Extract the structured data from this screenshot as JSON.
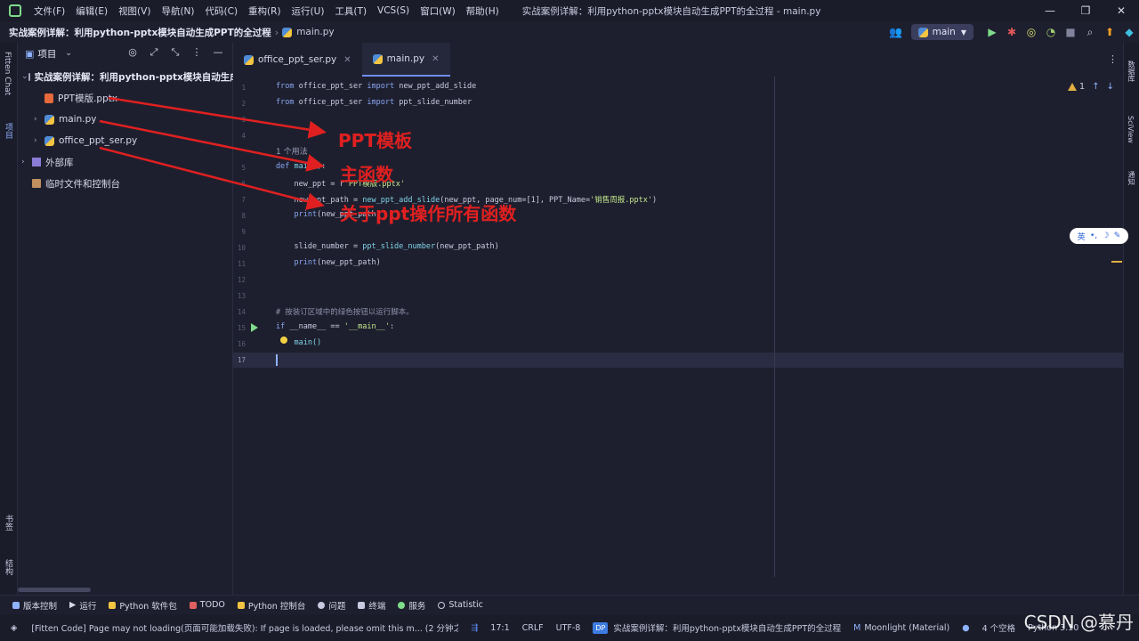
{
  "menu": {
    "items": [
      "文件(F)",
      "编辑(E)",
      "视图(V)",
      "导航(N)",
      "代码(C)",
      "重构(R)",
      "运行(U)",
      "工具(T)",
      "VCS(S)",
      "窗口(W)",
      "帮助(H)"
    ],
    "window_title": "实战案例详解：利用python-pptx模块自动生成PPT的全过程 - main.py"
  },
  "nav": {
    "project": "实战案例详解：利用python-pptx模块自动生成PPT的全过程",
    "file": "main.py",
    "run_config": "main"
  },
  "left_stripe": {
    "fitten": "Fitten Chat",
    "project": "项目",
    "bookmarks": "书签",
    "structure": "结构"
  },
  "project_panel": {
    "title": "项目",
    "tree": [
      {
        "label": "实战案例详解：利用python-pptx模块自动生成PPT的全过程"
      },
      {
        "label": "PPT模版.pptx"
      },
      {
        "label": "main.py"
      },
      {
        "label": "office_ppt_ser.py"
      },
      {
        "label": "外部库"
      },
      {
        "label": "临时文件和控制台"
      }
    ]
  },
  "tabs": [
    {
      "label": "office_ppt_ser.py"
    },
    {
      "label": "main.py"
    }
  ],
  "editor": {
    "line_numbers": [
      "1",
      "2",
      "3",
      "4",
      "5",
      "6",
      "7",
      "8",
      "9",
      "10",
      "11",
      "12",
      "13",
      "14",
      "15",
      "16",
      "17"
    ],
    "usage_hint": "1 个用法",
    "warnings": "1",
    "code": {
      "l1a": "from",
      "l1b": " office_ppt_ser ",
      "l1c": "import",
      "l1d": " new_ppt_add_slide",
      "l2a": "from",
      "l2b": " office_ppt_ser ",
      "l2c": "import",
      "l2d": " ppt_slide_number",
      "l5a": "def",
      "l5b": " main():",
      "l6a": "    new_ppt = r",
      "l6b": "'PPT模版.pptx'",
      "l7a": "    new_ppt_path = ",
      "l7b": "new_ppt_add_slide",
      "l7c": "(new_ppt, page_num=[1], PPT_Name=",
      "l7d": "'销售周报.pptx'",
      "l7e": ")",
      "l8a": "    ",
      "l8b": "print",
      "l8c": "(new_ppt_path)",
      "l10a": "    slide_number = ",
      "l10b": "ppt_slide_number",
      "l10c": "(new_ppt_path)",
      "l11a": "    ",
      "l11b": "print",
      "l11c": "(new_ppt_path)",
      "l14": "# 按装订区域中的绿色按钮以运行脚本。",
      "l15a": "if",
      "l15b": " __name__ == ",
      "l15c": "'__main__'",
      "l15d": ":",
      "l16": "    main()"
    }
  },
  "annotations": {
    "a1": "PPT模板",
    "a2": "主函数",
    "a3": "关于ppt操作所有函数"
  },
  "right_stripe": {
    "db": "数据库",
    "sciview": "SciView",
    "notify": "通知"
  },
  "ime": {
    "a": "英",
    "b": "•,",
    "c": "☽",
    "d": "✎"
  },
  "tool_windows": [
    "版本控制",
    "运行",
    "Python 软件包",
    "TODO",
    "Python 控制台",
    "问题",
    "终端",
    "服务",
    "Statistic"
  ],
  "status": {
    "message": "[Fitten Code] Page may not loading(页面可能加载失败): If page is loaded, please omit this m... (2 分钟之前)",
    "position": "17:1",
    "line_sep": "CRLF",
    "encoding": "UTF-8",
    "dp": "DP",
    "project": "实战案例详解：利用python-pptx模块自动生成PPT的全过程",
    "theme": "Moonlight (Material)",
    "indent": "4 个空格",
    "interpreter": "Python 3.10"
  },
  "watermark": "CSDN @慕丹",
  "colors": {
    "accent": "#6f8ef0",
    "annotation": "#e02020",
    "run": "#7fdc8a"
  }
}
